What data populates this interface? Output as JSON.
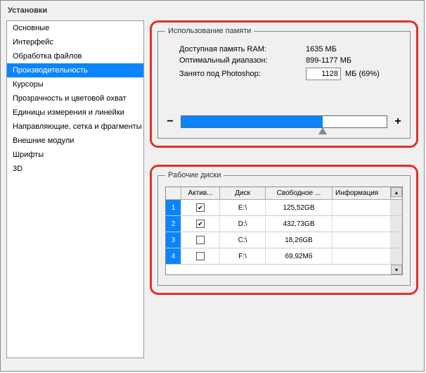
{
  "title": "Установки",
  "sidebar": {
    "items": [
      {
        "label": "Основные"
      },
      {
        "label": "Интерфейс"
      },
      {
        "label": "Обработка файлов"
      },
      {
        "label": "Производительность"
      },
      {
        "label": "Курсоры"
      },
      {
        "label": "Прозрачность и цветовой охват"
      },
      {
        "label": "Единицы измерения и линейки"
      },
      {
        "label": "Направляющие, сетка и фрагменты"
      },
      {
        "label": "Внешние модули"
      },
      {
        "label": "Шрифты"
      },
      {
        "label": "3D"
      }
    ],
    "selectedIndex": 3
  },
  "memory": {
    "legend": "Использование памяти",
    "available_label": "Доступная память RAM:",
    "available_value": "1635 МБ",
    "optimal_label": "Оптимальный диапазон:",
    "optimal_value": "899-1177 МБ",
    "used_label": "Занято под Photoshop:",
    "used_input": "1128",
    "used_suffix": "МБ (69%)",
    "minus": "−",
    "plus": "+",
    "slider_percent": 69
  },
  "disks": {
    "legend": "Рабочие диски",
    "headers": {
      "active": "Актив...",
      "disk": "Диск",
      "free": "Свободное ...",
      "info": "Информация"
    },
    "rows": [
      {
        "num": "1",
        "active": true,
        "disk": "E:\\",
        "free": "125,52GB",
        "info": ""
      },
      {
        "num": "2",
        "active": true,
        "disk": "D:\\",
        "free": "432,73GB",
        "info": ""
      },
      {
        "num": "3",
        "active": false,
        "disk": "C:\\",
        "free": "18,26GB",
        "info": ""
      },
      {
        "num": "4",
        "active": false,
        "disk": "F:\\",
        "free": "69,92Мб",
        "info": ""
      }
    ]
  }
}
